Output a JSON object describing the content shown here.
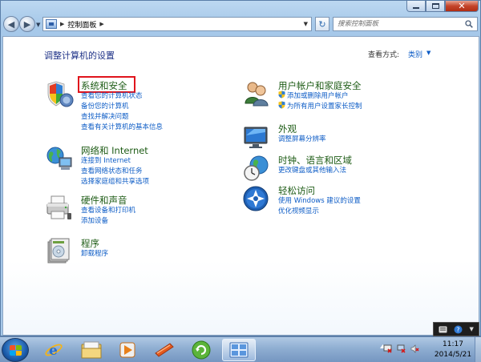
{
  "window": {
    "controls": {
      "minimize": "minimize",
      "maximize": "maximize",
      "close": "close"
    }
  },
  "address": {
    "path_item": "控制面板",
    "search_placeholder": "搜索控制面板"
  },
  "main": {
    "heading": "调整计算机的设置",
    "view_by_label": "查看方式:",
    "view_by_value": "类别"
  },
  "categories": {
    "system_security": {
      "title": "系统和安全",
      "links": [
        "查看您的计算机状态",
        "备份您的计算机",
        "查找并解决问题",
        "查看有关计算机的基本信息"
      ]
    },
    "network": {
      "title": "网络和 Internet",
      "links": [
        "连接到 Internet",
        "查看网络状态和任务",
        "选择家庭组和共享选项"
      ]
    },
    "hardware": {
      "title": "硬件和声音",
      "links": [
        "查看设备和打印机",
        "添加设备"
      ]
    },
    "programs": {
      "title": "程序",
      "links": [
        "卸载程序"
      ]
    },
    "user_accounts": {
      "title": "用户帐户和家庭安全",
      "links": [
        "添加或删除用户帐户",
        "为所有用户设置家长控制"
      ]
    },
    "appearance": {
      "title": "外观",
      "links": [
        "调整屏幕分辨率"
      ]
    },
    "clock_region": {
      "title": "时钟、语言和区域",
      "links": [
        "更改键盘或其他输入法"
      ]
    },
    "ease_access": {
      "title": "轻松访问",
      "links": [
        "使用 Windows 建议的设置",
        "优化视频显示"
      ]
    }
  },
  "taskbar": {
    "time": "11:17",
    "date": "2014/5/21"
  },
  "colors": {
    "heading": "#1e3287",
    "category_title": "#1e5c16",
    "link": "#0d5cc6",
    "highlight": "#e0141c"
  }
}
